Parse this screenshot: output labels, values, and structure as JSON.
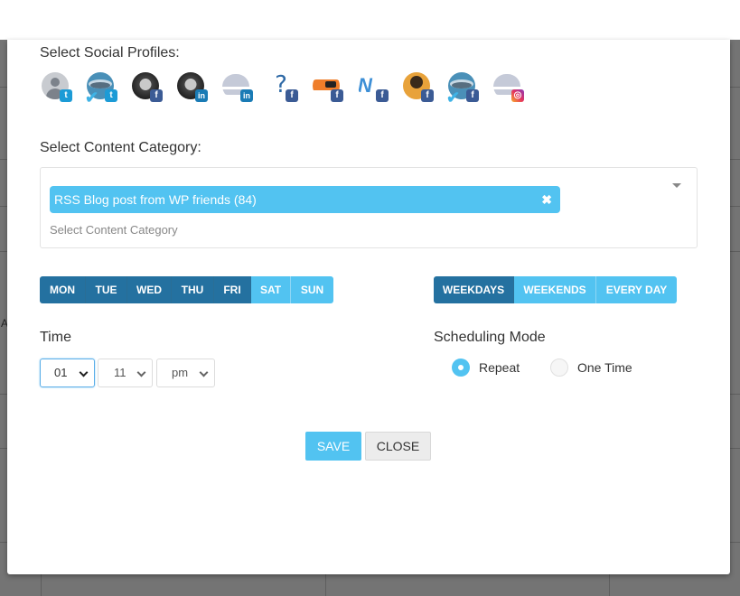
{
  "background": {
    "partial_text": "A"
  },
  "modal": {
    "social_profiles": {
      "label": "Select Social Profiles:",
      "items": [
        {
          "avatar": "default-user",
          "network": "twitter",
          "badge_glyph": "t"
        },
        {
          "avatar": "globe-check",
          "network": "twitter",
          "badge_glyph": "t"
        },
        {
          "avatar": "photo-woman",
          "network": "facebook",
          "badge_glyph": "f"
        },
        {
          "avatar": "photo-woman",
          "network": "linkedin",
          "badge_glyph": "in"
        },
        {
          "avatar": "dome",
          "network": "linkedin",
          "badge_glyph": "in"
        },
        {
          "avatar": "question-mark",
          "network": "facebook",
          "badge_glyph": "f"
        },
        {
          "avatar": "orange-device",
          "network": "facebook",
          "badge_glyph": "f"
        },
        {
          "avatar": "n-logo",
          "network": "facebook",
          "badge_glyph": "f"
        },
        {
          "avatar": "music-orange",
          "network": "facebook",
          "badge_glyph": "f"
        },
        {
          "avatar": "globe-check",
          "network": "facebook",
          "badge_glyph": "f"
        },
        {
          "avatar": "dome",
          "network": "instagram",
          "badge_glyph": "◎"
        }
      ]
    },
    "content_category": {
      "label": "Select Content Category:",
      "selected": [
        "RSS Blog post from WP friends (84)"
      ],
      "remove_glyph": "✖",
      "placeholder": "Select Content Category"
    },
    "days": {
      "items": [
        {
          "label": "MON",
          "selected": true
        },
        {
          "label": "TUE",
          "selected": true
        },
        {
          "label": "WED",
          "selected": true
        },
        {
          "label": "THU",
          "selected": true
        },
        {
          "label": "FRI",
          "selected": true
        },
        {
          "label": "SAT",
          "selected": false
        },
        {
          "label": "SUN",
          "selected": false
        }
      ]
    },
    "presets": {
      "items": [
        {
          "label": "WEEKDAYS",
          "selected": true
        },
        {
          "label": "WEEKENDS",
          "selected": false
        },
        {
          "label": "EVERY DAY",
          "selected": false
        }
      ]
    },
    "time": {
      "label": "Time",
      "hour": "01",
      "minute": "11",
      "ampm": "pm"
    },
    "scheduling_mode": {
      "label": "Scheduling Mode",
      "options": [
        {
          "label": "Repeat",
          "selected": true
        },
        {
          "label": "One Time",
          "selected": false
        }
      ]
    },
    "actions": {
      "save": "SAVE",
      "close": "CLOSE"
    },
    "colors": {
      "accent": "#52c3f1",
      "selected_dark": "#2471a0",
      "facebook": "#3b5b95",
      "twitter": "#1c9bd6",
      "linkedin": "#1a7bb5"
    }
  }
}
